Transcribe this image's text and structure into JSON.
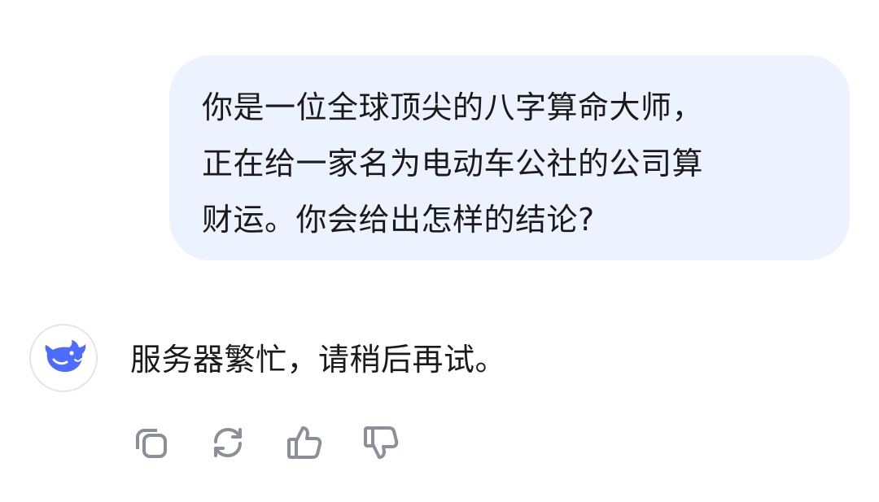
{
  "conversation": {
    "user_message": "你是一位全球顶尖的八字算命大师，\n正在给一家名为电动车公社的公司算\n财运。你会给出怎样的结论?",
    "assistant_message": "服务器繁忙，请稍后再试。"
  },
  "assistant": {
    "avatar_icon": "whale-logo-icon",
    "brand_color": "#4d6bfe"
  },
  "actions": {
    "icons": [
      "copy-icon",
      "regenerate-icon",
      "thumbs-up-icon",
      "thumbs-down-icon"
    ],
    "icon_color": "#8b8f98"
  },
  "colors": {
    "bubble_background": "#edf3fe",
    "text": "#1a1a1a"
  }
}
